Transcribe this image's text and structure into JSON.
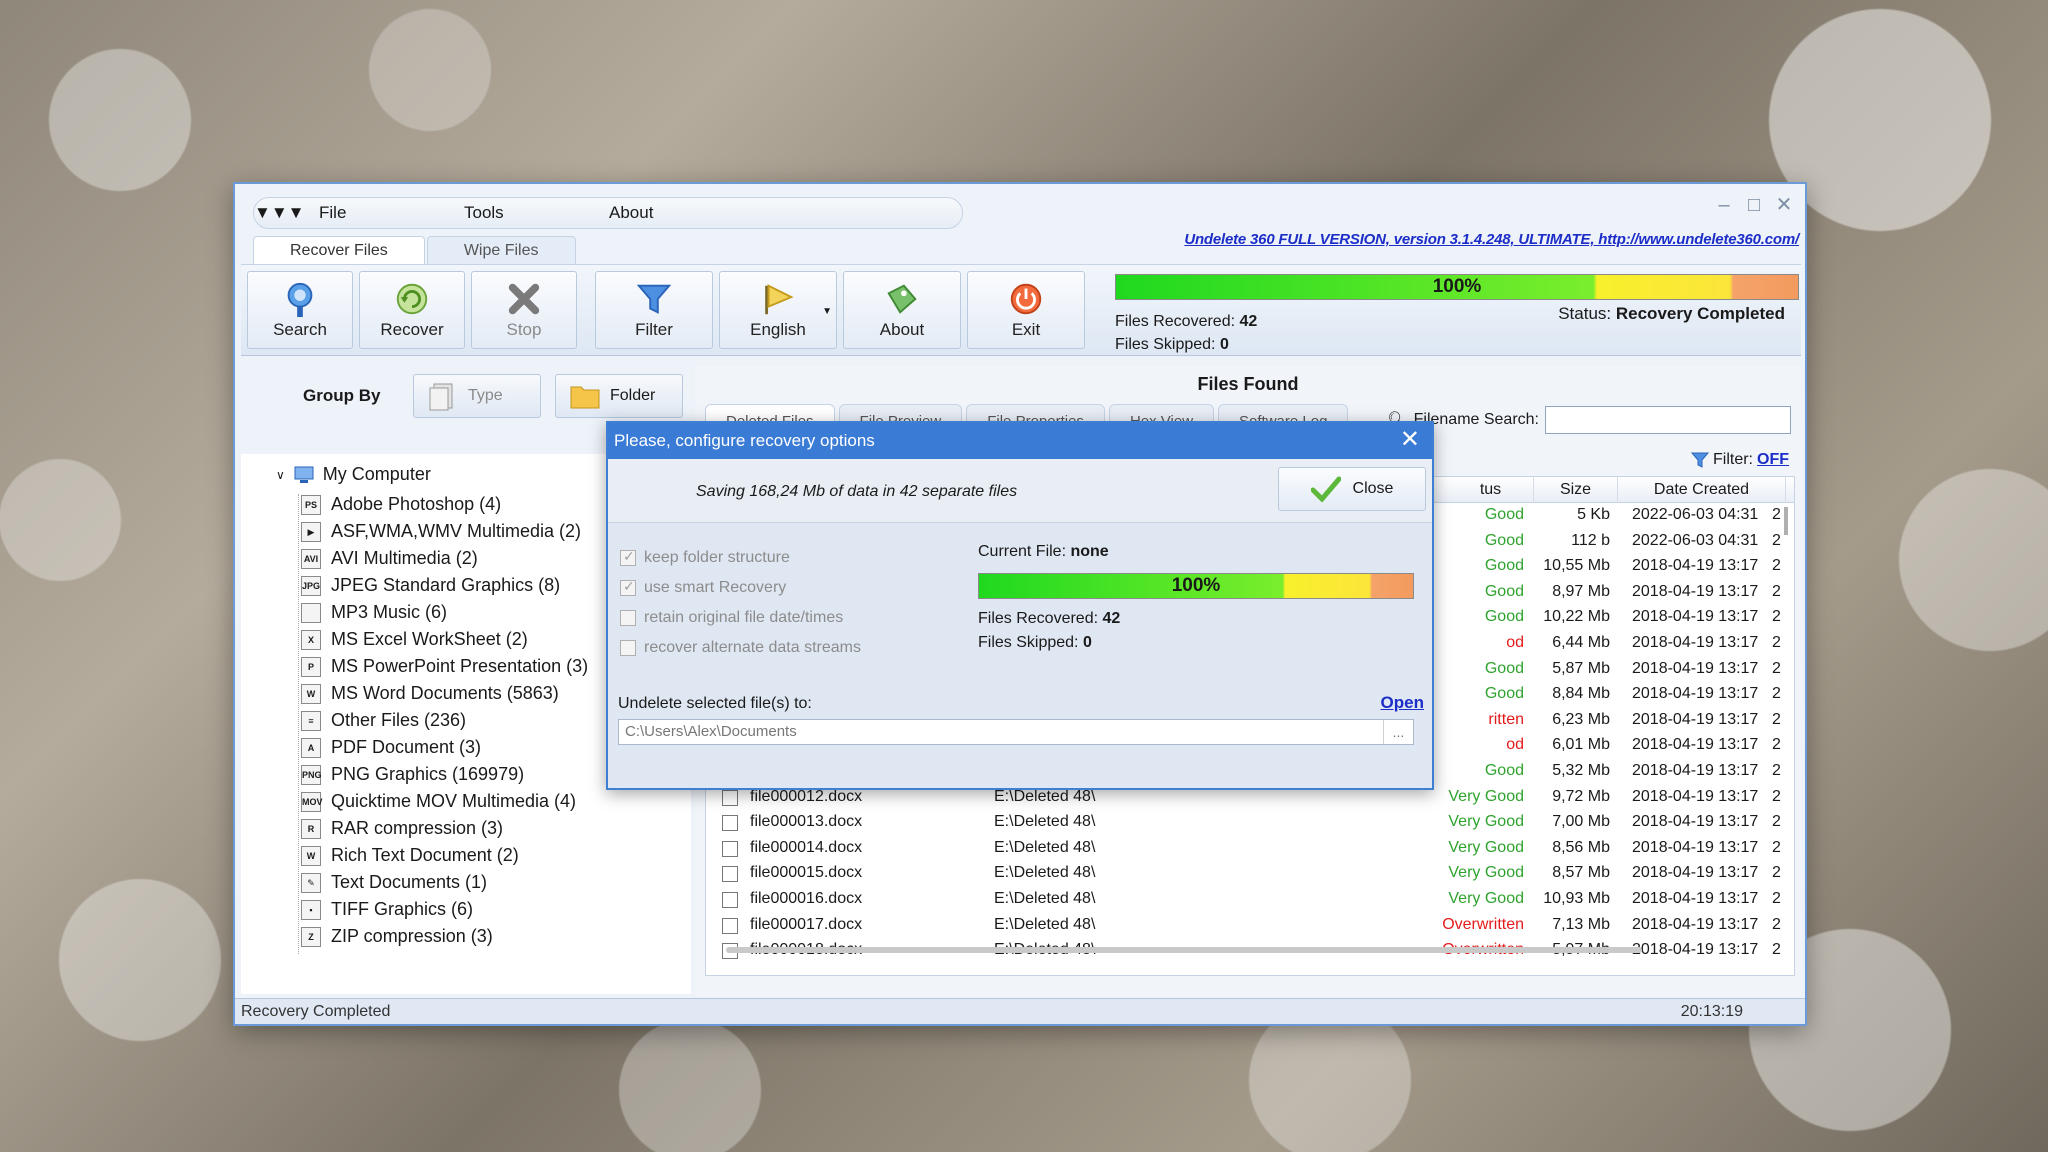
{
  "menu": {
    "file": "File",
    "tools": "Tools",
    "about": "About"
  },
  "version_link": "Undelete 360 FULL VERSION, version 3.1.4.248, ULTIMATE, http://www.undelete360.com/",
  "top_tabs": [
    "Recover Files",
    "Wipe Files"
  ],
  "toolbar": {
    "search": "Search",
    "recover": "Recover",
    "stop": "Stop",
    "filter": "Filter",
    "language": "English",
    "about": "About",
    "exit": "Exit"
  },
  "progress": {
    "percent_label": "100%",
    "fraction": 1.0,
    "files_recovered_label": "Files Recovered:",
    "files_recovered": "42",
    "files_skipped_label": "Files Skipped:",
    "files_skipped": "0",
    "status_label": "Status:",
    "status": "Recovery Completed"
  },
  "groupby": {
    "label": "Group By",
    "type": "Type",
    "folder": "Folder"
  },
  "tree": {
    "root": "My Computer",
    "items": [
      {
        "label": "Adobe Photoshop (4)",
        "abbr": "PS"
      },
      {
        "label": "ASF,WMA,WMV Multimedia (2)",
        "abbr": "▶"
      },
      {
        "label": "AVI Multimedia (2)",
        "abbr": "AVI"
      },
      {
        "label": "JPEG Standard Graphics (8)",
        "abbr": "JPG"
      },
      {
        "label": "MP3 Music (6)",
        "abbr": ""
      },
      {
        "label": "MS Excel WorkSheet (2)",
        "abbr": "X"
      },
      {
        "label": "MS PowerPoint Presentation (3)",
        "abbr": "P"
      },
      {
        "label": "MS Word Documents (5863)",
        "abbr": "W"
      },
      {
        "label": "Other Files (236)",
        "abbr": "≡"
      },
      {
        "label": "PDF Document (3)",
        "abbr": "A"
      },
      {
        "label": "PNG Graphics (169979)",
        "abbr": "PNG"
      },
      {
        "label": "Quicktime MOV Multimedia (4)",
        "abbr": "MOV"
      },
      {
        "label": "RAR compression (3)",
        "abbr": "R"
      },
      {
        "label": "Rich Text Document (2)",
        "abbr": "W"
      },
      {
        "label": "Text Documents (1)",
        "abbr": "✎"
      },
      {
        "label": "TIFF Graphics (6)",
        "abbr": "▪"
      },
      {
        "label": "ZIP compression (3)",
        "abbr": "Z"
      }
    ]
  },
  "files_panel": {
    "title": "Files Found",
    "tabs": [
      "Deleted Files",
      "File Preview",
      "File Properties",
      "Hex View",
      "Software Log"
    ],
    "search_label": "Filename Search:",
    "search_value": "",
    "filter_label": "Filter:",
    "filter_state": "OFF",
    "columns": [
      "tus",
      "Size",
      "Date Created"
    ],
    "rows": [
      {
        "name": "",
        "path": "",
        "status": "Good",
        "status_class": "good",
        "size": "5 Kb",
        "date": "2022-06-03 04:31",
        "extra": "2"
      },
      {
        "name": "",
        "path": "",
        "status": "Good",
        "status_class": "good",
        "size": "112 b",
        "date": "2022-06-03 04:31",
        "extra": "2"
      },
      {
        "name": "",
        "path": "",
        "status": "Good",
        "status_class": "good",
        "size": "10,55 Mb",
        "date": "2018-04-19 13:17",
        "extra": "2"
      },
      {
        "name": "",
        "path": "",
        "status": "Good",
        "status_class": "good",
        "size": "8,97 Mb",
        "date": "2018-04-19 13:17",
        "extra": "2"
      },
      {
        "name": "",
        "path": "",
        "status": "Good",
        "status_class": "good",
        "size": "10,22 Mb",
        "date": "2018-04-19 13:17",
        "extra": "2"
      },
      {
        "name": "",
        "path": "",
        "status": "od",
        "status_class": "bad",
        "size": "6,44 Mb",
        "date": "2018-04-19 13:17",
        "extra": "2"
      },
      {
        "name": "",
        "path": "",
        "status": "Good",
        "status_class": "good",
        "size": "5,87 Mb",
        "date": "2018-04-19 13:17",
        "extra": "2"
      },
      {
        "name": "",
        "path": "",
        "status": "Good",
        "status_class": "good",
        "size": "8,84 Mb",
        "date": "2018-04-19 13:17",
        "extra": "2"
      },
      {
        "name": "",
        "path": "",
        "status": "ritten",
        "status_class": "bad",
        "size": "6,23 Mb",
        "date": "2018-04-19 13:17",
        "extra": "2"
      },
      {
        "name": "",
        "path": "",
        "status": "od",
        "status_class": "bad",
        "size": "6,01 Mb",
        "date": "2018-04-19 13:17",
        "extra": "2"
      },
      {
        "name": "",
        "path": "",
        "status": "Good",
        "status_class": "good",
        "size": "5,32 Mb",
        "date": "2018-04-19 13:17",
        "extra": "2"
      },
      {
        "name": "file000012.docx",
        "path": "E:\\Deleted 48\\",
        "status": "Very Good",
        "status_class": "good",
        "size": "9,72 Mb",
        "date": "2018-04-19 13:17",
        "extra": "2"
      },
      {
        "name": "file000013.docx",
        "path": "E:\\Deleted 48\\",
        "status": "Very Good",
        "status_class": "good",
        "size": "7,00 Mb",
        "date": "2018-04-19 13:17",
        "extra": "2"
      },
      {
        "name": "file000014.docx",
        "path": "E:\\Deleted 48\\",
        "status": "Very Good",
        "status_class": "good",
        "size": "8,56 Mb",
        "date": "2018-04-19 13:17",
        "extra": "2"
      },
      {
        "name": "file000015.docx",
        "path": "E:\\Deleted 48\\",
        "status": "Very Good",
        "status_class": "good",
        "size": "8,57 Mb",
        "date": "2018-04-19 13:17",
        "extra": "2"
      },
      {
        "name": "file000016.docx",
        "path": "E:\\Deleted 48\\",
        "status": "Very Good",
        "status_class": "good",
        "size": "10,93 Mb",
        "date": "2018-04-19 13:17",
        "extra": "2"
      },
      {
        "name": "file000017.docx",
        "path": "E:\\Deleted 48\\",
        "status": "Overwritten",
        "status_class": "bad",
        "size": "7,13 Mb",
        "date": "2018-04-19 13:17",
        "extra": "2"
      },
      {
        "name": "file000018.docx",
        "path": "E:\\Deleted 48\\",
        "status": "Overwritten",
        "status_class": "bad",
        "size": "5,97 Mb",
        "date": "2018-04-19 13:17",
        "extra": "2"
      }
    ]
  },
  "statusbar": {
    "left": "Recovery Completed",
    "right": "20:13:19"
  },
  "dialog": {
    "title": "Please, configure recovery options",
    "saving": "Saving 168,24 Mb of data in 42 separate files",
    "close_label": "Close",
    "options": [
      {
        "label": "keep folder structure",
        "checked": true
      },
      {
        "label": "use smart Recovery",
        "checked": true
      },
      {
        "label": "retain original file date/times",
        "checked": false
      },
      {
        "label": "recover alternate data streams",
        "checked": false
      }
    ],
    "current_file_label": "Current File:",
    "current_file": "none",
    "percent_label": "100%",
    "files_recovered_label": "Files Recovered:",
    "files_recovered": "42",
    "files_skipped_label": "Files Skipped:",
    "files_skipped": "0",
    "undelete_label": "Undelete selected file(s) to:",
    "open_label": "Open",
    "path": "C:\\Users\\Alex\\Documents",
    "browse": "..."
  },
  "colors": {
    "accent": "#3a7bd5",
    "good": "#2ea32e",
    "bad": "#e31b1b",
    "link": "#1c2dc8"
  }
}
